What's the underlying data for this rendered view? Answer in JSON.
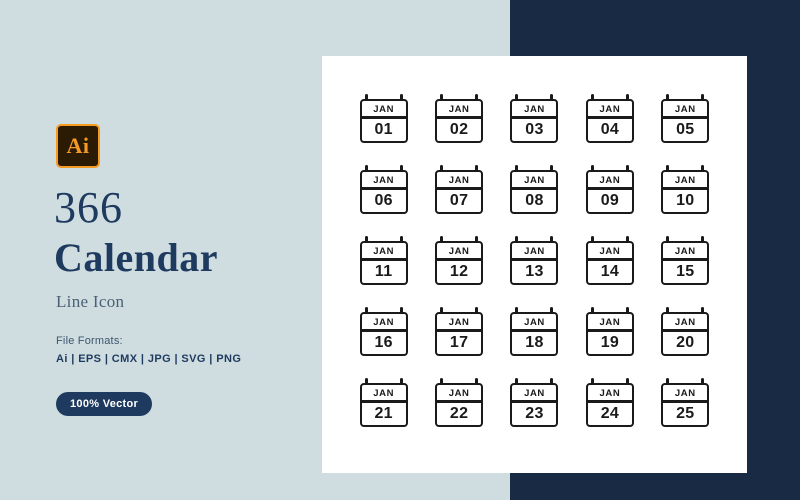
{
  "panels": {
    "left_bg": "#cfdde0",
    "right_bg": "#192a45",
    "card_bg": "#ffffff"
  },
  "info": {
    "badge_label": "Ai",
    "count": "366",
    "title": "Calendar",
    "subtitle": "Line Icon",
    "formats_label": "File Formats:",
    "formats_list": "Ai  |  EPS  |  CMX  |  JPG  |  SVG  |  PNG",
    "vector_badge": "100% Vector",
    "accent_color": "#1e3a5f",
    "badge_border": "#f59a23"
  },
  "icons": [
    {
      "month": "JAN",
      "day": "01"
    },
    {
      "month": "JAN",
      "day": "02"
    },
    {
      "month": "JAN",
      "day": "03"
    },
    {
      "month": "JAN",
      "day": "04"
    },
    {
      "month": "JAN",
      "day": "05"
    },
    {
      "month": "JAN",
      "day": "06"
    },
    {
      "month": "JAN",
      "day": "07"
    },
    {
      "month": "JAN",
      "day": "08"
    },
    {
      "month": "JAN",
      "day": "09"
    },
    {
      "month": "JAN",
      "day": "10"
    },
    {
      "month": "JAN",
      "day": "11"
    },
    {
      "month": "JAN",
      "day": "12"
    },
    {
      "month": "JAN",
      "day": "13"
    },
    {
      "month": "JAN",
      "day": "14"
    },
    {
      "month": "JAN",
      "day": "15"
    },
    {
      "month": "JAN",
      "day": "16"
    },
    {
      "month": "JAN",
      "day": "17"
    },
    {
      "month": "JAN",
      "day": "18"
    },
    {
      "month": "JAN",
      "day": "19"
    },
    {
      "month": "JAN",
      "day": "20"
    },
    {
      "month": "JAN",
      "day": "21"
    },
    {
      "month": "JAN",
      "day": "22"
    },
    {
      "month": "JAN",
      "day": "23"
    },
    {
      "month": "JAN",
      "day": "24"
    },
    {
      "month": "JAN",
      "day": "25"
    }
  ]
}
